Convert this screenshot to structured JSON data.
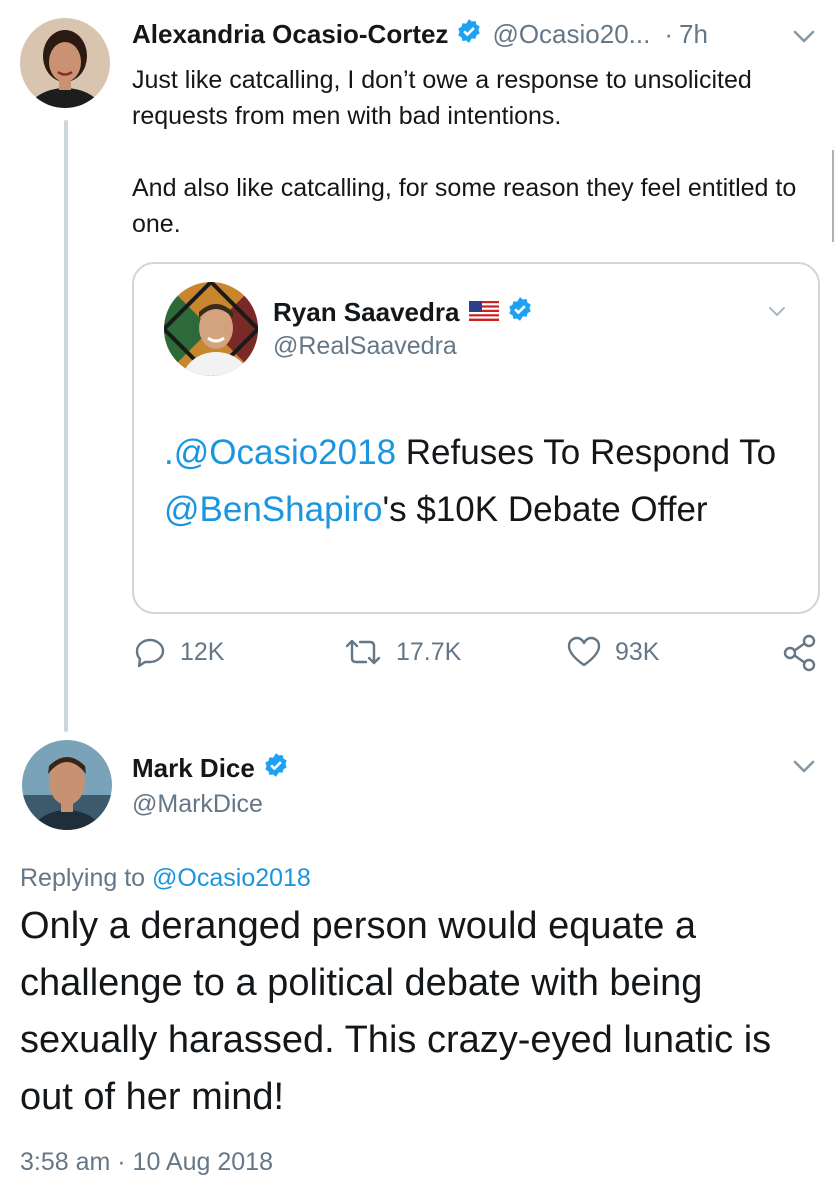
{
  "tweet1": {
    "author_name": "Alexandria Ocasio-Cortez",
    "author_handle": "@Ocasio20...",
    "separator": "·",
    "time": "7h",
    "text_para1": "Just like catcalling, I don’t owe a response to unsolicited requests from men with bad intentions.",
    "text_para2": "And also like catcalling, for some reason they feel entitled to one.",
    "quoted": {
      "author_name": "Ryan Saavedra",
      "author_handle": "@RealSaavedra",
      "mention1": ".@Ocasio2018",
      "text1": " Refuses To Respond To ",
      "mention2": "@BenShapiro",
      "text2": "'s $10K Debate Offer"
    },
    "actions": {
      "replies": "12K",
      "retweets": "17.7K",
      "likes": "93K"
    }
  },
  "tweet2": {
    "author_name": "Mark Dice",
    "author_handle": "@MarkDice",
    "replying_prefix": "Replying to ",
    "replying_handle": "@Ocasio2018",
    "text": "Only a deranged person would equate a challenge to a political debate with being sexually harassed.  This crazy-eyed lunatic is out of her mind!",
    "timestamp": "3:58 am · 10 Aug 2018"
  },
  "colors": {
    "link": "#1b95e0",
    "muted": "#657786",
    "verified": "#1da1f2",
    "border": "#ccd6dd"
  }
}
